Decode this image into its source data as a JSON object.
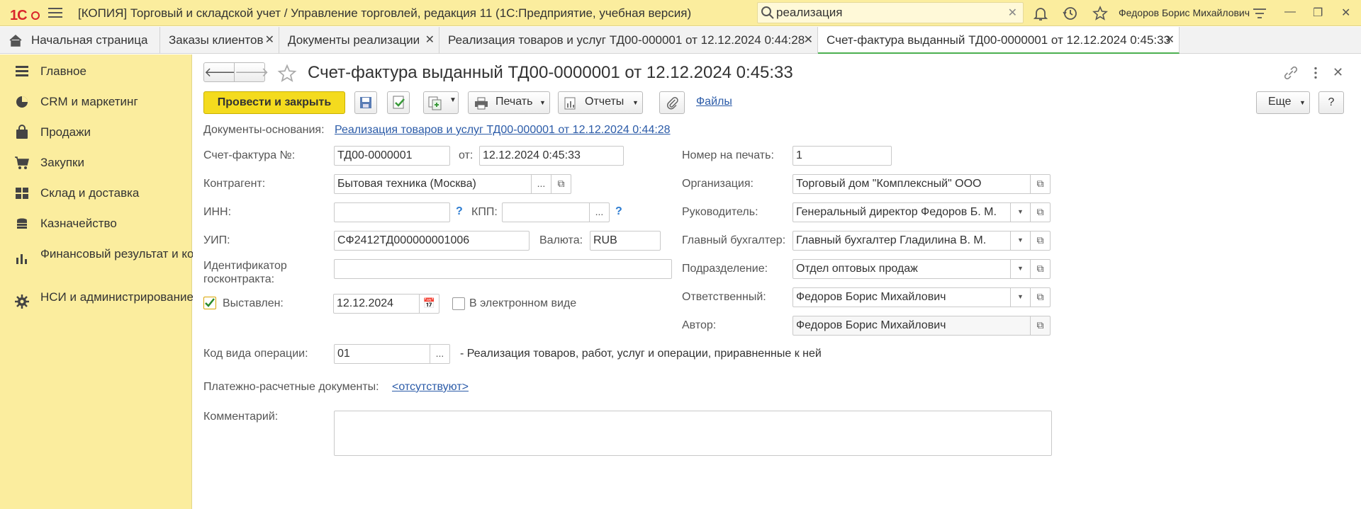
{
  "app": {
    "logo": "1С",
    "title": "[КОПИЯ] Торговый и складской учет / Управление торговлей, редакция 11  (1С:Предприятие, учебная версия)",
    "search_value": "реализация",
    "user": "Федоров Борис Михайлович"
  },
  "tabs": [
    {
      "label": "Начальная страница"
    },
    {
      "label": "Заказы клиентов"
    },
    {
      "label": "Документы реализации"
    },
    {
      "label": "Реализация товаров и услуг ТД00-000001 от 12.12.2024 0:44:28"
    },
    {
      "label": "Счет-фактура выданный ТД00-0000001 от 12.12.2024 0:45:33"
    }
  ],
  "sidebar": {
    "items": [
      {
        "label": "Главное",
        "icon": "menu-lines-icon"
      },
      {
        "label": "CRM и маркетинг",
        "icon": "pie-chart-icon"
      },
      {
        "label": "Продажи",
        "icon": "bag-icon"
      },
      {
        "label": "Закупки",
        "icon": "cart-icon"
      },
      {
        "label": "Склад и доставка",
        "icon": "grid-warehouse-icon"
      },
      {
        "label": "Казначейство",
        "icon": "coins-icon"
      },
      {
        "label": "Финансовый результат и контроллинг",
        "icon": "bar-chart-icon"
      },
      {
        "label": "НСИ и администрирование",
        "icon": "gear-icon"
      }
    ]
  },
  "document": {
    "title": "Счет-фактура выданный ТД00-0000001 от 12.12.2024 0:45:33"
  },
  "toolbar": {
    "post_close": "Провести и закрыть",
    "print": "Печать",
    "reports": "Отчеты",
    "files": "Файлы",
    "more": "Еще",
    "help": "?"
  },
  "form": {
    "basis_label": "Документы-основания:",
    "basis_link": "Реализация товаров и услуг ТД00-000001 от 12.12.2024 0:44:28",
    "invoice_no_label": "Счет-фактура №:",
    "invoice_no": "ТД00-0000001",
    "from_label": "от:",
    "from_value": "12.12.2024  0:45:33",
    "print_no_label": "Номер на печать:",
    "print_no": "1",
    "counterparty_label": "Контрагент:",
    "counterparty": "Бытовая техника (Москва)",
    "org_label": "Организация:",
    "org": "Торговый дом \"Комплексный\" ООО",
    "inn_label": "ИНН:",
    "inn": "",
    "kpp_label": "КПП:",
    "kpp": "",
    "head_label": "Руководитель:",
    "head": "Генеральный директор Федоров Б. М.",
    "uip_label": "УИП:",
    "uip": "СФ2412ТД000000001006",
    "currency_label": "Валюта:",
    "currency": "RUB",
    "chief_acc_label": "Главный бухгалтер:",
    "chief_acc": "Главный бухгалтер Гладилина В. М.",
    "gov_id_label": "Идентификатор госконтракта:",
    "gov_id": "",
    "dept_label": "Подразделение:",
    "dept": "Отдел оптовых продаж",
    "issued_label": "Выставлен:",
    "issued_date": "12.12.2024",
    "electronic_label": "В электронном виде",
    "responsible_label": "Ответственный:",
    "responsible": "Федоров Борис Михайлович",
    "author_label": "Автор:",
    "author": "Федоров Борис Михайлович",
    "op_code_label": "Код вида операции:",
    "op_code": "01",
    "op_code_desc": "- Реализация товаров, работ, услуг и операции, приравненные к ней",
    "payment_docs_label": "Платежно-расчетные документы:",
    "payment_docs_link": "<отсутствуют>",
    "comment_label": "Комментарий:",
    "comment": ""
  },
  "colors": {
    "accent": "#f4db1e",
    "sidebar": "#fbed9e",
    "link": "#2b5ba8",
    "active_tab_underline": "#4caf50"
  }
}
